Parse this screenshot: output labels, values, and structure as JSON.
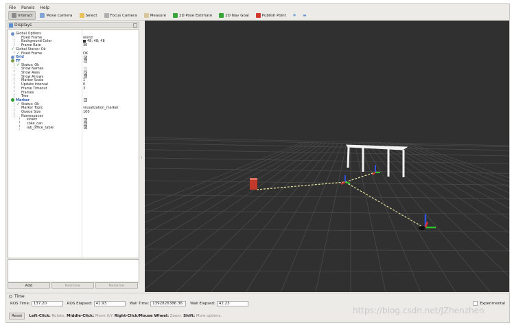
{
  "menu": {
    "file": "File",
    "panels": "Panels",
    "help": "Help"
  },
  "toolbar": [
    {
      "label": "Interact",
      "icon": "interact-icon",
      "color": "#8a8a8a",
      "active": true
    },
    {
      "label": "Move Camera",
      "icon": "move-camera-icon",
      "color": "#7fa6d6"
    },
    {
      "label": "Select",
      "icon": "select-icon",
      "color": "#e8c45a"
    },
    {
      "label": "Focus Camera",
      "icon": "focus-camera-icon",
      "color": "#b0b0b0"
    },
    {
      "label": "Measure",
      "icon": "measure-icon",
      "color": "#d9c79a"
    },
    {
      "label": "2D Pose Estimate",
      "icon": "pose-estimate-icon",
      "color": "#3aa63a"
    },
    {
      "label": "2D Nav Goal",
      "icon": "nav-goal-icon",
      "color": "#3aa63a"
    },
    {
      "label": "Publish Point",
      "icon": "publish-point-icon",
      "color": "#d0392b"
    }
  ],
  "displays": {
    "title": "Displays",
    "rows": [
      {
        "name": "Global Options",
        "value": "",
        "level": 1,
        "icon": "gear"
      },
      {
        "name": "Fixed Frame",
        "value": "world",
        "level": 2
      },
      {
        "name": "Background Color",
        "value": "48; 48; 48",
        "level": 2,
        "swatch": true
      },
      {
        "name": "Frame Rate",
        "value": "30",
        "level": 2
      },
      {
        "name": "Global Status: Ok",
        "value": "",
        "level": 1,
        "icon": "check"
      },
      {
        "name": "Fixed Frame",
        "value": "OK",
        "level": 2,
        "icon": "check"
      },
      {
        "name": "Grid",
        "value": "",
        "level": 1,
        "icon": "grid",
        "style": "blue",
        "checkbox": true
      },
      {
        "name": "TF",
        "value": "",
        "level": 1,
        "icon": "tf",
        "style": "blue",
        "checkbox": true
      },
      {
        "name": "Status: Ok",
        "value": "",
        "level": 2,
        "icon": "check"
      },
      {
        "name": "Show Names",
        "value": "",
        "level": 2,
        "checkbox": "disabled"
      },
      {
        "name": "Show Axes",
        "value": "",
        "level": 2,
        "checkbox": true
      },
      {
        "name": "Show Arrows",
        "value": "",
        "level": 2,
        "checkbox": true
      },
      {
        "name": "Marker Scale",
        "value": "1",
        "level": 2
      },
      {
        "name": "Update Interval",
        "value": "0",
        "level": 2
      },
      {
        "name": "Frame Timeout",
        "value": "3",
        "level": 2
      },
      {
        "name": "Frames",
        "value": "",
        "level": 2
      },
      {
        "name": "Tree",
        "value": "",
        "level": 2
      },
      {
        "name": "Marker",
        "value": "",
        "level": 1,
        "icon": "marker",
        "style": "blue",
        "checkbox": true
      },
      {
        "name": "Status: Ok",
        "value": "",
        "level": 2,
        "icon": "check"
      },
      {
        "name": "Marker Topic",
        "value": "visualization_marker",
        "level": 2
      },
      {
        "name": "Queue Size",
        "value": "100",
        "level": 2
      },
      {
        "name": "Namespaces",
        "value": "",
        "level": 2
      },
      {
        "name": "kinect",
        "value": "",
        "level": 3,
        "checkbox": true
      },
      {
        "name": "coke_can",
        "value": "",
        "level": 3,
        "checkbox": true
      },
      {
        "name": "lab_office_table",
        "value": "",
        "level": 3,
        "checkbox": true
      }
    ]
  },
  "buttons": {
    "add": "Add",
    "remove": "Remove",
    "rename": "Rename"
  },
  "time": {
    "title": "Time",
    "ros_time_label": "ROS Time:",
    "ros_time": "137.20",
    "ros_elapsed_label": "ROS Elapsed:",
    "ros_elapsed": "41.93",
    "wall_time_label": "Wall Time:",
    "wall_time": "1392826386.36",
    "wall_elapsed_label": "Wall Elapsed:",
    "wall_elapsed": "42.23",
    "experimental": "Experimental"
  },
  "status": {
    "reset": "Reset",
    "hint1": "Left-Click:",
    "hint1_text": " Rotate. ",
    "hint2": "Middle-Click:",
    "hint2_text": " Move X/Y. ",
    "hint3": "Right-Click/Mouse Wheel:",
    "hint3_text": " Zoom. ",
    "hint4": "Shift:",
    "hint4_text": " More options."
  },
  "watermark": "https://blog.csdn.net/JZhenzhen",
  "colors": {
    "viewport_bg": "#303030",
    "grid_line": "#4a4a4a",
    "tf_link": "#e6e6a0",
    "axis_x": "#e03030",
    "axis_y": "#30c030",
    "axis_z": "#3050e0"
  }
}
